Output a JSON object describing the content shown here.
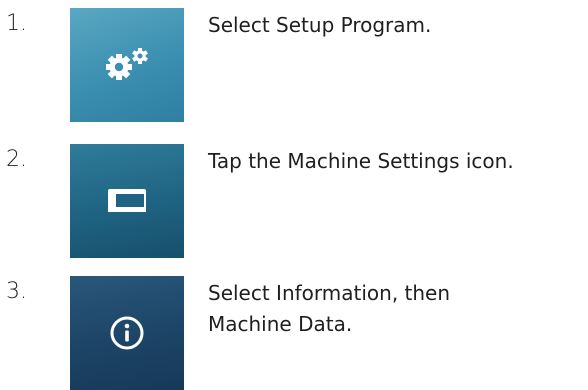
{
  "steps": [
    {
      "number": "1.",
      "icon": "gears-icon",
      "text_lines": [
        "Select Setup Program."
      ]
    },
    {
      "number": "2.",
      "icon": "sewing-machine-icon",
      "text_lines": [
        "Tap the Machine Settings icon."
      ]
    },
    {
      "number": "3.",
      "icon": "info-icon",
      "text_lines": [
        "Select Information, then",
        "Machine Data."
      ]
    }
  ],
  "colors": {
    "tile_1": "#3b8fb0",
    "tile_2": "#1f6382",
    "tile_3": "#1d4466",
    "icon": "#ffffff",
    "text": "#1f1f1f"
  }
}
